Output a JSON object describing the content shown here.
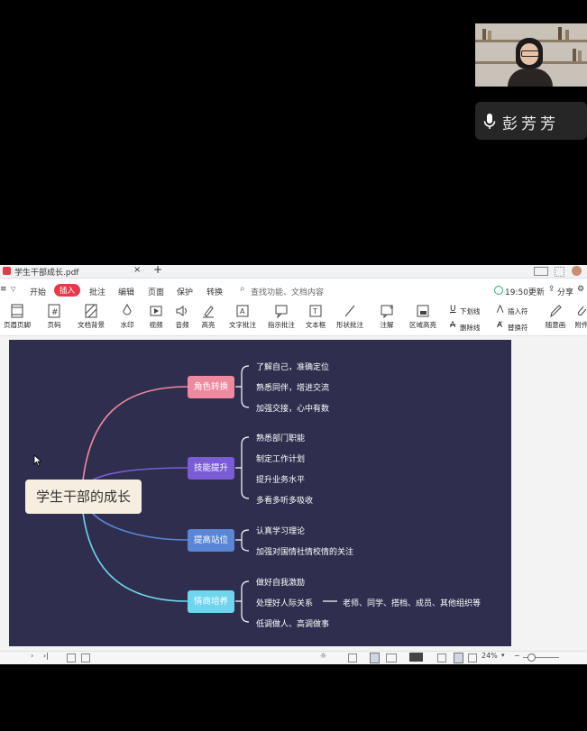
{
  "meeting": {
    "speaker_name": "彭芳芳",
    "mic_icon": "microphone-icon"
  },
  "app": {
    "file_title": "学生干部成长.pdf",
    "new_tab": "+",
    "menu_tabs": [
      "开始",
      "插入",
      "批注",
      "编辑",
      "页面",
      "保护",
      "转换"
    ],
    "active_tab": "插入",
    "search_placeholder": "查找功能、文档内容",
    "sync_status": "19:50更新",
    "share_label": "分享",
    "ribbon_items": [
      "页眉页脚",
      "页码",
      "文档背景",
      "水印",
      "视频",
      "音频",
      "高亮",
      "文字批注",
      "指示批注",
      "文本框",
      "形状批注",
      "注解",
      "区域高亮"
    ],
    "ribbon_right": {
      "underline": "下划线",
      "insert_symbol": "插入符",
      "strikethrough": "删除线",
      "replace_symbol": "替换符",
      "freehand": "随意画",
      "attachment": "附件"
    },
    "accent_color": "#e8394b",
    "zoom": "24%"
  },
  "mindmap": {
    "root": "学生干部的成长",
    "branches": [
      {
        "label": "角色转换",
        "color": "#ee8aa0",
        "leaves": [
          "了解自己，准确定位",
          "熟悉同伴，增进交流",
          "加强交接，心中有数"
        ]
      },
      {
        "label": "技能提升",
        "color": "#7a5cd6",
        "leaves": [
          "熟悉部门职能",
          "制定工作计划",
          "提升业务水平",
          "多看多听多吸收"
        ]
      },
      {
        "label": "提高站位",
        "color": "#5b86d6",
        "leaves": [
          "认真学习理论",
          "加强对国情社情校情的关注"
        ]
      },
      {
        "label": "情商培养",
        "color": "#6fd4ee",
        "leaves": [
          "做好自我激励",
          "处理好人际关系",
          "低调做人、高调做事"
        ]
      }
    ],
    "extra_note": "老师、同学、搭档、成员、其他组织等"
  }
}
